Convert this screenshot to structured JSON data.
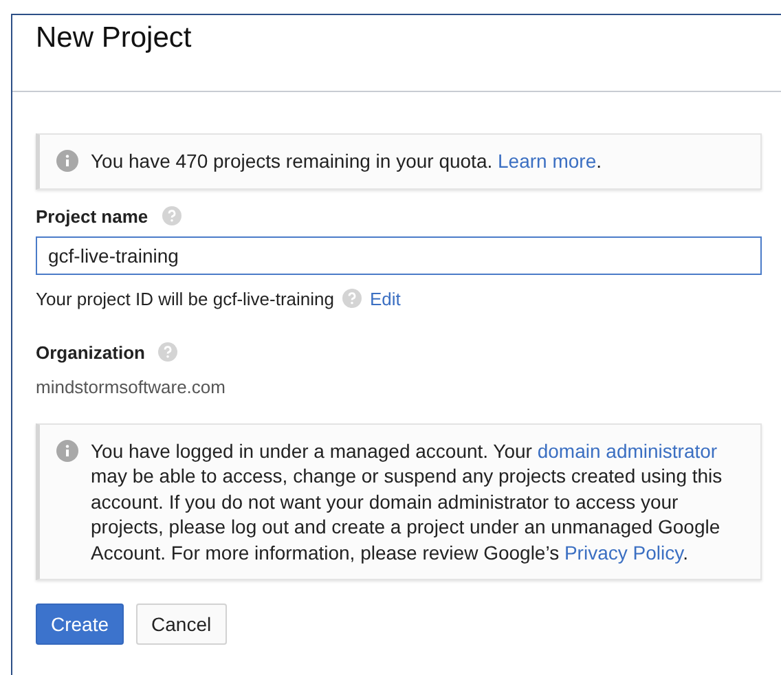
{
  "dialog": {
    "title": "New Project"
  },
  "quota_notice": {
    "parts": [
      {
        "kind": "text",
        "text": "You have 470 projects remaining in your quota. "
      },
      {
        "kind": "link",
        "text": "Learn more"
      },
      {
        "kind": "text",
        "text": "."
      }
    ]
  },
  "project_name": {
    "label": "Project name",
    "value": "gcf-live-training"
  },
  "project_id": {
    "text": "Your project ID will be gcf-live-training",
    "edit": "Edit"
  },
  "organization": {
    "label": "Organization",
    "value": "mindstormsoftware.com"
  },
  "account_notice": {
    "parts": [
      {
        "kind": "text",
        "text": "You have logged in under a managed account. Your "
      },
      {
        "kind": "link",
        "text": "domain administrator"
      },
      {
        "kind": "text",
        "text": " may be able to access, change or suspend any projects created using this account. If you do not want your domain administrator to access your projects, please log out and create a project under an unmanaged Google Account. For more information, please review Google’s "
      },
      {
        "kind": "link",
        "text": "Privacy Policy"
      },
      {
        "kind": "text",
        "text": "."
      }
    ]
  },
  "buttons": [
    {
      "label": "Create",
      "kind": "primary"
    },
    {
      "label": "Cancel",
      "kind": "secondary"
    }
  ]
}
